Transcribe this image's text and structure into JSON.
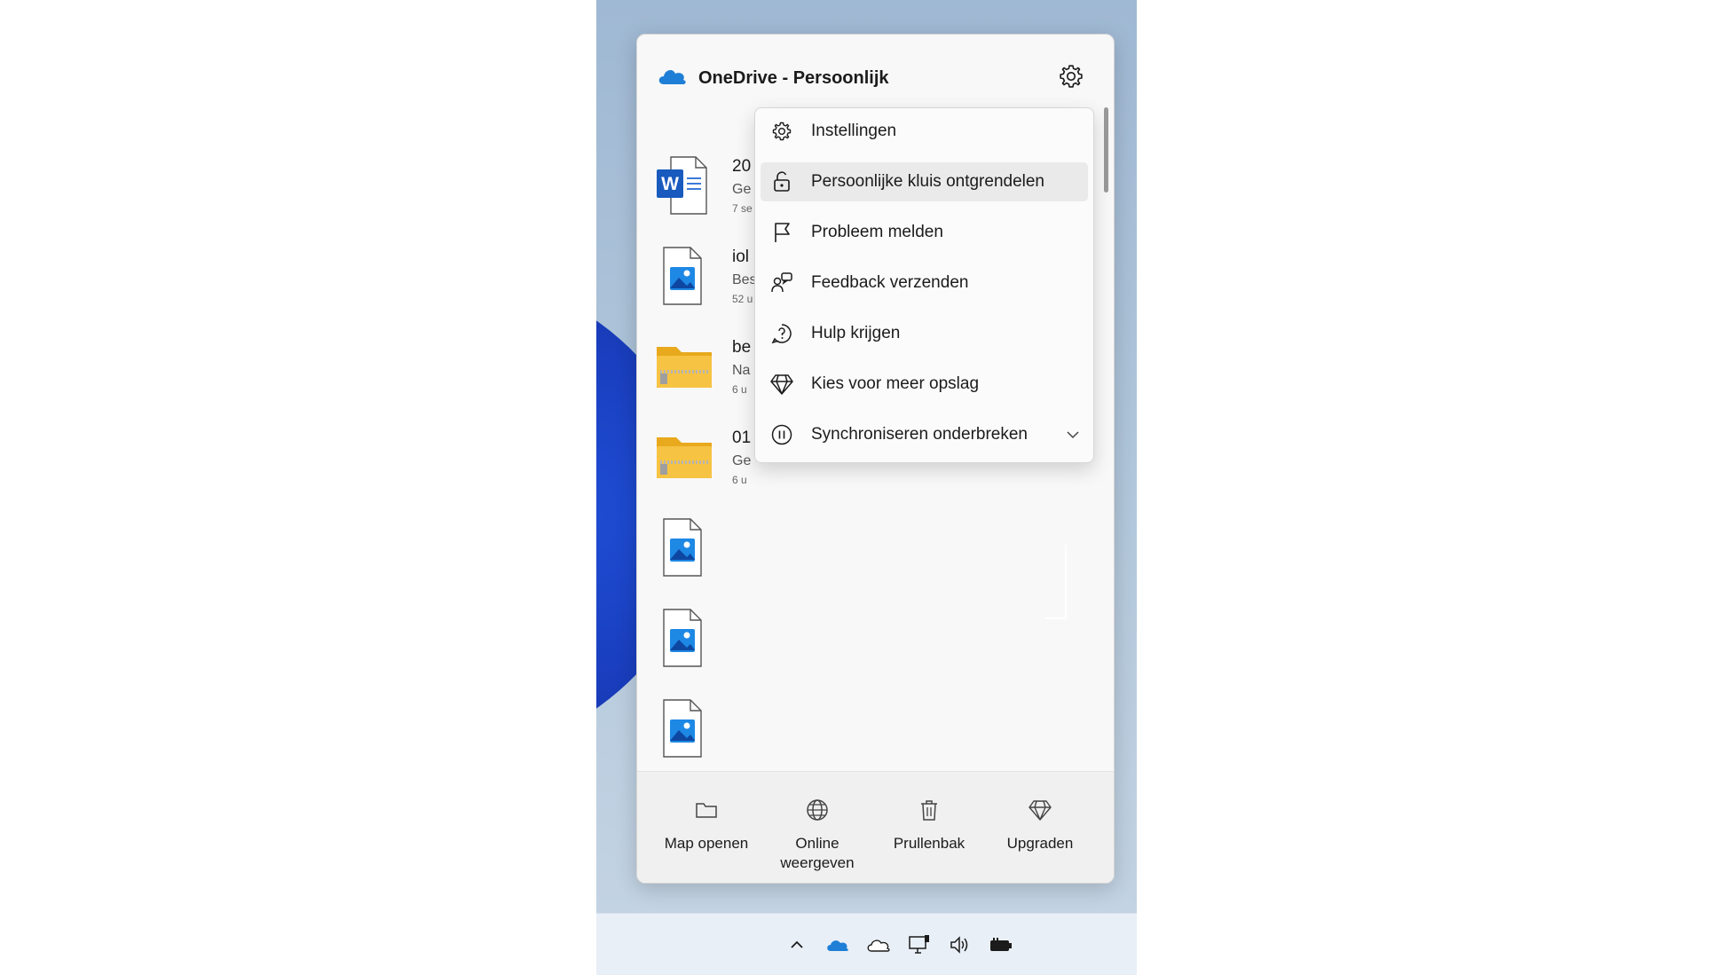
{
  "header": {
    "title": "OneDrive - Persoonlijk",
    "settings_icon": "gear-icon"
  },
  "files": [
    {
      "icon": "word-document-icon",
      "name": "20",
      "subtitle": "Ge",
      "time": "7 se"
    },
    {
      "icon": "image-file-icon",
      "name": "iol",
      "subtitle": "Bes",
      "time": "52 u"
    },
    {
      "icon": "zip-folder-icon",
      "name": "be",
      "subtitle": "Na",
      "time": "6 u"
    },
    {
      "icon": "zip-folder-icon",
      "name": "01",
      "subtitle": "Ge",
      "time": "6 u"
    },
    {
      "icon": "image-file-icon",
      "name": "",
      "subtitle": "",
      "time": ""
    },
    {
      "icon": "image-file-icon",
      "name": "",
      "subtitle": "",
      "time": ""
    },
    {
      "icon": "image-file-icon",
      "name": "",
      "subtitle": "",
      "time": ""
    },
    {
      "icon": "image-file-icon",
      "name": "",
      "subtitle": "",
      "time": ""
    }
  ],
  "menu": {
    "items": [
      {
        "label": "Instellingen",
        "icon": "gear-icon"
      },
      {
        "label": "Persoonlijke kluis ontgrendelen",
        "icon": "unlock-icon",
        "highlighted": true
      },
      {
        "label": "Probleem melden",
        "icon": "flag-icon"
      },
      {
        "label": "Feedback verzenden",
        "icon": "feedback-icon"
      },
      {
        "label": "Hulp krijgen",
        "icon": "help-icon"
      },
      {
        "label": "Kies voor meer opslag",
        "icon": "diamond-icon"
      },
      {
        "label": "Synchroniseren onderbreken",
        "icon": "pause-icon",
        "has_submenu": true
      }
    ]
  },
  "footer": {
    "actions": [
      {
        "label": "Map openen",
        "icon": "folder-icon"
      },
      {
        "label": "Online weergeven",
        "icon": "globe-icon"
      },
      {
        "label": "Prullenbak",
        "icon": "trash-icon"
      },
      {
        "label": "Upgraden",
        "icon": "diamond-icon"
      }
    ]
  },
  "taskbar": {
    "tray_icons": [
      "chevron-up-icon",
      "onedrive-icon",
      "cloud-outline-icon",
      "network-icon",
      "volume-icon",
      "battery-icon"
    ]
  },
  "colors": {
    "accent": "#0f6cbd",
    "cloud_blue": "#1f7fd6",
    "folder_yellow": "#f6c343",
    "hover_bg": "#eaeaea"
  }
}
